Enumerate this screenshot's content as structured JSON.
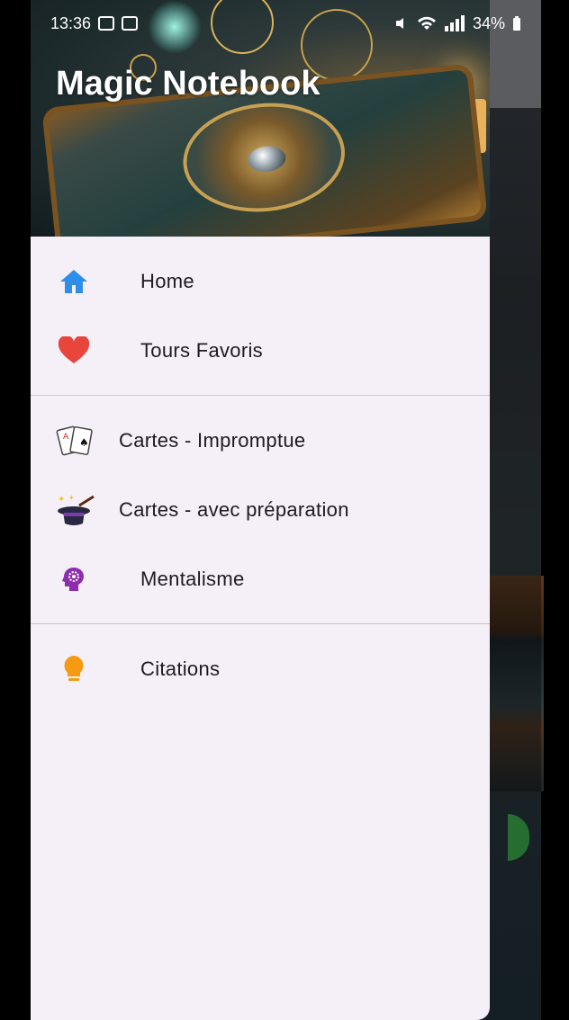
{
  "status_bar": {
    "time": "13:36",
    "battery": "34%"
  },
  "drawer": {
    "header": {
      "title": "Magic Notebook"
    },
    "sections": [
      {
        "items": [
          {
            "label": "Home",
            "icon": "home-icon",
            "icon_color": "#2f8ee8"
          },
          {
            "label": "Tours Favoris",
            "icon": "heart-icon",
            "icon_color": "#e8453c"
          }
        ]
      },
      {
        "items": [
          {
            "label": "Cartes - Impromptue",
            "icon": "playing-cards-icon"
          },
          {
            "label": "Cartes - avec préparation",
            "icon": "magic-hat-icon"
          },
          {
            "label": "Mentalisme",
            "icon": "mind-gear-icon",
            "icon_color": "#8e2cb0"
          }
        ]
      },
      {
        "items": [
          {
            "label": "Citations",
            "icon": "lightbulb-icon",
            "icon_color": "#f59a12"
          }
        ]
      }
    ]
  },
  "background": {
    "scrim": true
  }
}
